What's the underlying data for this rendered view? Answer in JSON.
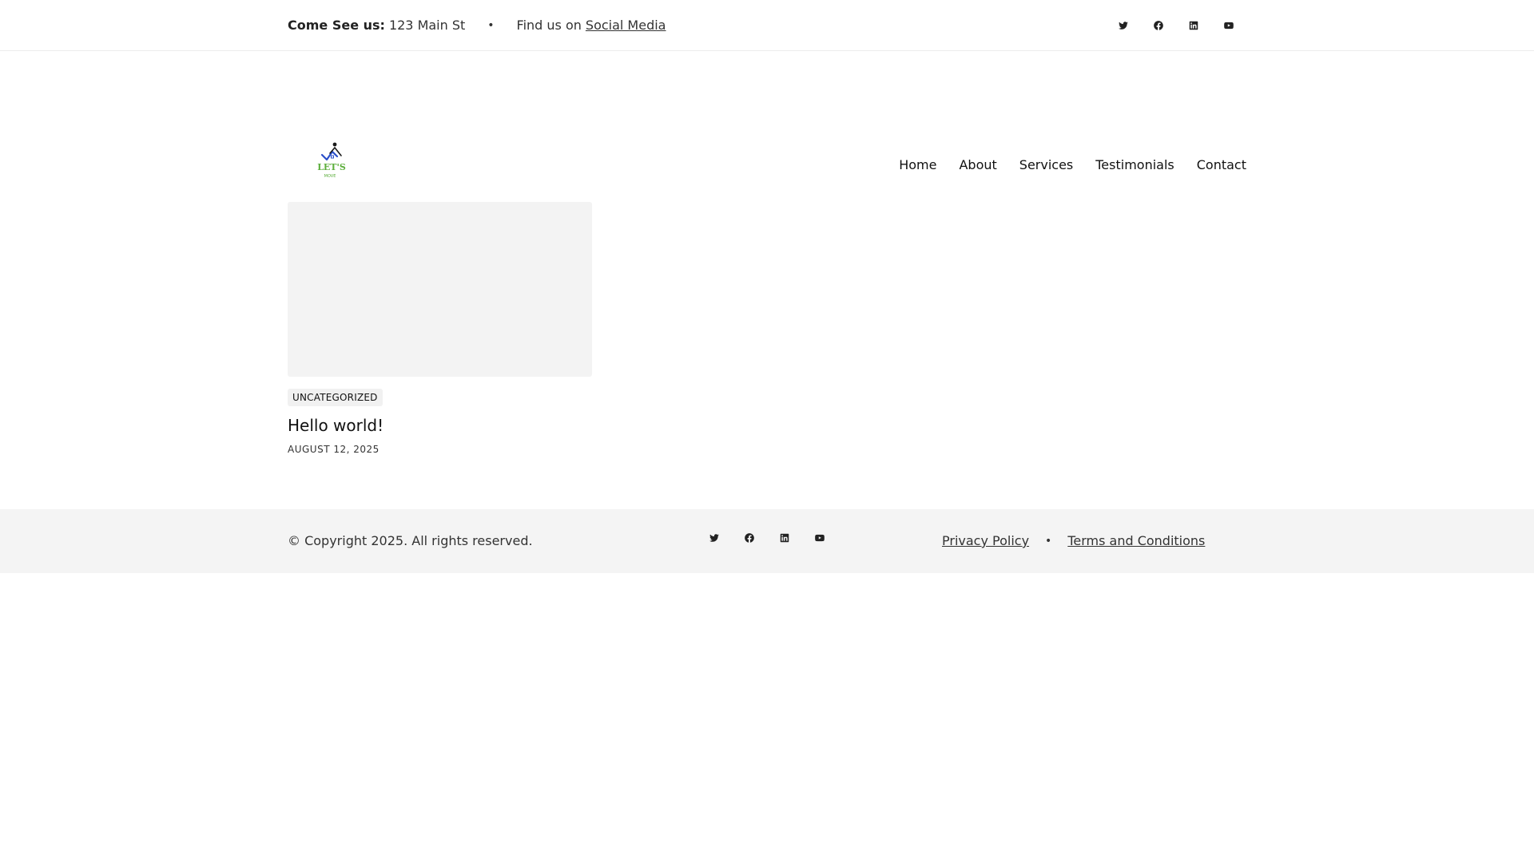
{
  "topbar": {
    "address_label": "Come See us:",
    "address_value": "123 Main St",
    "separator": "•",
    "find_prefix": "Find us on",
    "find_link": "Social Media",
    "socials": [
      "twitter-icon",
      "facebook-icon",
      "linkedin-icon",
      "youtube-icon"
    ]
  },
  "header": {
    "logo_text": "LET'S",
    "logo_subtext": "MOVE",
    "nav": [
      "Home",
      "About",
      "Services",
      "Testimonials",
      "Contact"
    ]
  },
  "post": {
    "category": "UNCATEGORIZED",
    "title": "Hello world!",
    "date": "AUGUST 12, 2025"
  },
  "footer": {
    "copyright": "© Copyright 2025. All rights reserved.",
    "socials": [
      "twitter-icon",
      "facebook-icon",
      "linkedin-icon",
      "youtube-icon"
    ],
    "privacy": "Privacy Policy",
    "separator": "•",
    "terms": "Terms and Conditions"
  },
  "colors": {
    "logo_blue": "#2b4fc9",
    "logo_green": "#5cae3c",
    "footer_bg": "#f4f4f4",
    "image_placeholder": "#f3f3f3"
  }
}
